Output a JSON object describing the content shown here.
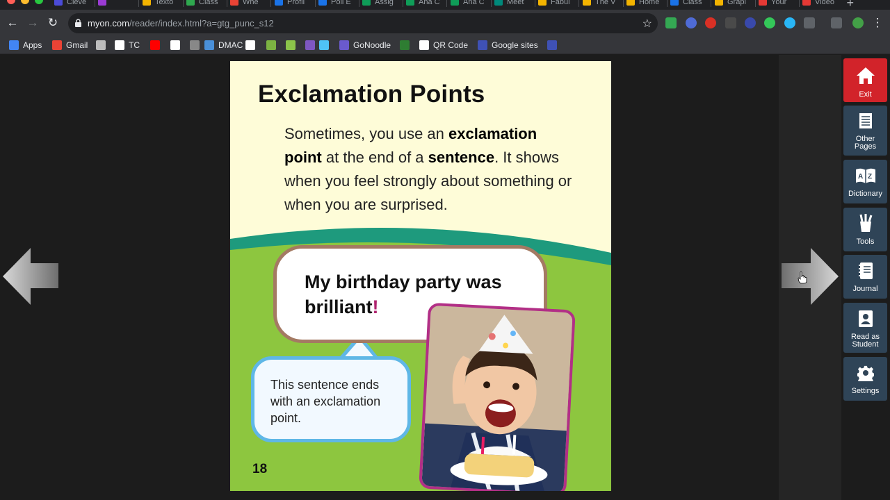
{
  "browser": {
    "tabs": [
      {
        "title": "Cleve",
        "favicon_color": "#4b4bd8"
      },
      {
        "title": "",
        "favicon_color": "#9b3bd4"
      },
      {
        "title": "Texto",
        "favicon_color": "#f4b400"
      },
      {
        "title": "Class",
        "favicon_color": "#2fa84f"
      },
      {
        "title": "Whe",
        "favicon_color": "#ea4335"
      },
      {
        "title": "Profil",
        "favicon_color": "#1a73e8"
      },
      {
        "title": "Poll E",
        "favicon_color": "#1a73e8"
      },
      {
        "title": "Assig",
        "favicon_color": "#0f9d58"
      },
      {
        "title": "Ana C",
        "favicon_color": "#0f9d58"
      },
      {
        "title": "Ana C",
        "favicon_color": "#0f9d58"
      },
      {
        "title": "Meet",
        "favicon_color": "#00897b"
      },
      {
        "title": "Fabul",
        "favicon_color": "#f4b400"
      },
      {
        "title": "The V",
        "favicon_color": "#f4b400"
      },
      {
        "title": "Home",
        "favicon_color": "#f4b400"
      },
      {
        "title": "Class",
        "favicon_color": "#1a73e8"
      },
      {
        "title": "Grapl",
        "favicon_color": "#f4b400"
      },
      {
        "title": "Your",
        "favicon_color": "#e53935"
      },
      {
        "title": "Video",
        "favicon_color": "#e53935"
      }
    ],
    "url_host": "myon.com",
    "url_path": "/reader/index.html?a=gtg_punc_s12",
    "bookmarks": [
      {
        "label": "Apps",
        "color": "#4285f4"
      },
      {
        "label": "Gmail",
        "color": "#ea4335"
      },
      {
        "label": "",
        "color": "#bdbdbd"
      },
      {
        "label": "TC",
        "color": "#ffffff"
      },
      {
        "label": "",
        "color": "#ff0000"
      },
      {
        "label": "",
        "color": "#ffffff"
      },
      {
        "label": "",
        "color": "#888888"
      },
      {
        "label": "DMAC",
        "color": "#4a90d9"
      },
      {
        "label": "",
        "color": "#ffffff"
      },
      {
        "label": "",
        "color": "#7cb342"
      },
      {
        "label": "",
        "color": "#8bc34a"
      },
      {
        "label": "",
        "color": "#7e57c2"
      },
      {
        "label": "",
        "color": "#4fc3f7"
      },
      {
        "label": "GoNoodle",
        "color": "#6a5acd"
      },
      {
        "label": "",
        "color": "#2e7d32"
      },
      {
        "label": "QR Code",
        "color": "#ffffff"
      },
      {
        "label": "Google sites",
        "color": "#3f51b5"
      },
      {
        "label": "",
        "color": "#3f51b5"
      }
    ]
  },
  "page": {
    "title": "Exclamation Points",
    "body_1": "Sometimes, you use an ",
    "body_bold_1": "exclamation point",
    "body_2": " at the end of a ",
    "body_bold_2": "sentence",
    "body_3": ". It shows when you feel strongly about something or when you are surprised.",
    "example_line_1": "My birthday party was",
    "example_line_2": "brilliant",
    "example_mark": "!",
    "note": "This sentence ends with an exclamation point.",
    "page_number": "18"
  },
  "menu": {
    "exit": "Exit",
    "other_pages_1": "Other",
    "other_pages_2": "Pages",
    "dictionary": "Dictionary",
    "tools": "Tools",
    "journal": "Journal",
    "read_as_student_1": "Read as",
    "read_as_student_2": "Student",
    "settings": "Settings"
  },
  "colors": {
    "exit_red": "#d2232a",
    "menu_blue": "#2f4457",
    "page_cream": "#fefcd8",
    "grass_green": "#8dc63f",
    "teal_band": "#1e9a7d",
    "exclamation_magenta": "#b0246f"
  }
}
